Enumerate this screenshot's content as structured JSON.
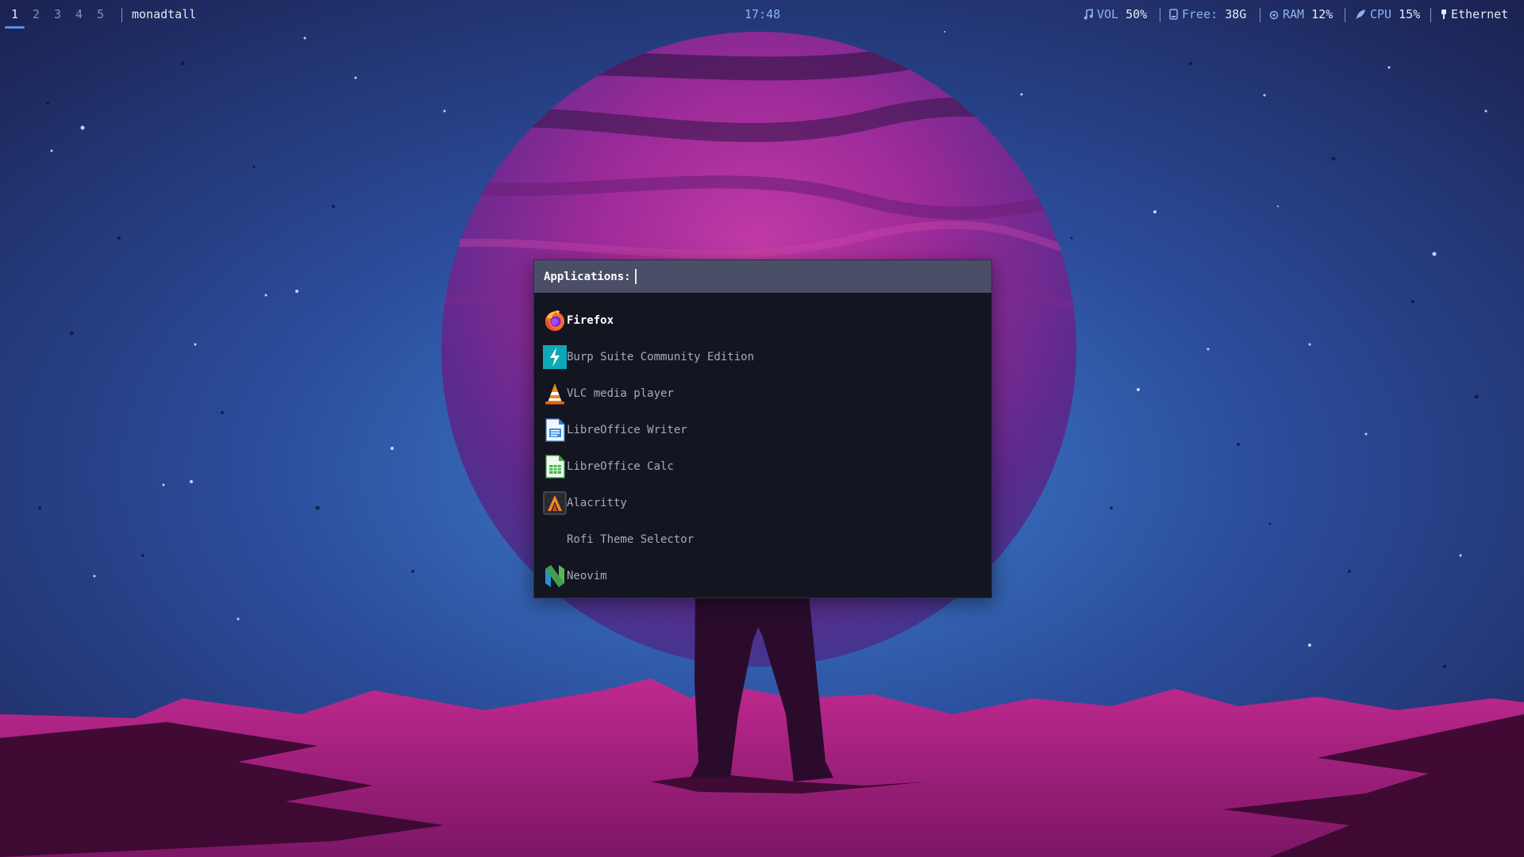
{
  "topbar": {
    "workspaces": [
      "1",
      "2",
      "3",
      "4",
      "5"
    ],
    "active_workspace": "1",
    "layout": "monadtall",
    "clock": "17:48",
    "modules": {
      "volume": {
        "icon": "music-note-icon",
        "label": "VOL",
        "value": "50%"
      },
      "disk": {
        "icon": "hard-drive-icon",
        "label": "Free:",
        "value": "38G"
      },
      "ram": {
        "icon": "memory-chip-icon",
        "label": "RAM",
        "value": "12%"
      },
      "cpu": {
        "icon": "rocket-icon",
        "label": "CPU",
        "value": "15%"
      },
      "network": {
        "icon": "ethernet-plug-icon",
        "value": "Ethernet"
      }
    }
  },
  "launcher": {
    "prompt": "Applications:",
    "query": "",
    "selected_index": 0,
    "items": [
      {
        "name": "Firefox",
        "icon": "firefox-icon"
      },
      {
        "name": "Burp Suite Community Edition",
        "icon": "burp-suite-icon"
      },
      {
        "name": "VLC media player",
        "icon": "vlc-cone-icon"
      },
      {
        "name": "LibreOffice Writer",
        "icon": "libreoffice-writer-icon"
      },
      {
        "name": "LibreOffice Calc",
        "icon": "libreoffice-calc-icon"
      },
      {
        "name": "Alacritty",
        "icon": "alacritty-icon"
      },
      {
        "name": "Rofi Theme Selector",
        "icon": ""
      },
      {
        "name": "Neovim",
        "icon": "neovim-icon"
      }
    ]
  },
  "colors": {
    "accent": "#5b8fe0",
    "bar_label": "#8fb3f0",
    "launcher_bg": "#131520",
    "prompt_bg": "#4a4e66",
    "planet_magenta": "#b02a9a",
    "ground_magenta": "#9c1f7c"
  }
}
